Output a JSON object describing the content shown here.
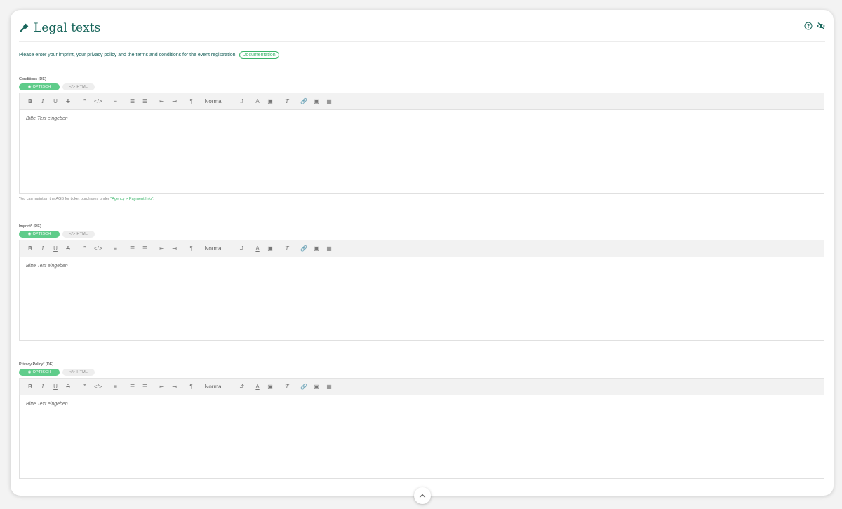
{
  "page": {
    "title": "Legal texts",
    "intro": "Please enter your imprint, your privacy policy and the terms and conditions for the event registration.",
    "doc_link": "Documentation"
  },
  "editor_common": {
    "mode_visual": "OPTISCH",
    "mode_html": "HTML",
    "format_select": "Normal",
    "placeholder": "Bitte Text eingeben",
    "toolbar_icons": [
      "bold-icon",
      "italic-icon",
      "underline-icon",
      "strike-icon",
      "quote-icon",
      "code-icon",
      "align-icon",
      "ordered-list-icon",
      "bullet-list-icon",
      "indent-decrease-icon",
      "indent-increase-icon",
      "text-direction-icon",
      "font-color-icon",
      "background-color-icon",
      "clear-format-icon",
      "link-icon",
      "image-icon",
      "video-icon"
    ]
  },
  "editors": [
    {
      "label": "Conditions (DE)",
      "note_prefix": "You can maintain the AGB for ticket purchases under ",
      "note_link": "\"Agency > Payment Info\"",
      "note_suffix": "."
    },
    {
      "label": "Imprint* (DE)"
    },
    {
      "label": "Privacy Policy* (DE)"
    }
  ],
  "colors": {
    "accent": "#17655a",
    "green": "#5fcc8a",
    "link": "#3bb56a"
  }
}
